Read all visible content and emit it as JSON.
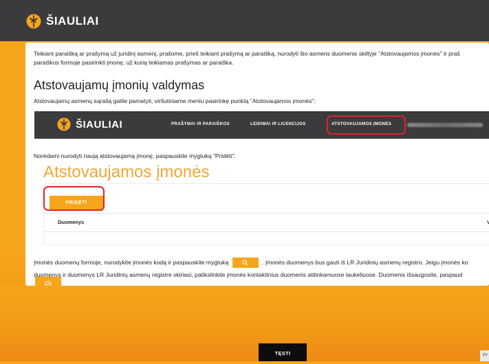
{
  "header": {
    "brand": "ŠIAULIAI"
  },
  "intro": {
    "line1": "Teikiant paraišką ar prašymą už juridinį asmenį, prašome, prieš teikiant prašymą ar paraišką, nurodyti šio asmens duomenis skiltyje \"Atstovaujamos įmonės\" ir praš",
    "line2": "paraiškos formoje pasirinkti įmonę, už kurią teikiamas prašymas ar paraiška."
  },
  "section": {
    "title": "Atstovaujamų įmonių valdymas",
    "subline": "Atstovaujamų asmenų sąrašą galite pamatyti, viršutiniame meniu pasirinkę punktą \"Atstovaujamos įmonės\":"
  },
  "nav_shot": {
    "brand": "ŠIAULIAI",
    "items": [
      "PRAŠYMAI IR PARAIŠKOS",
      "LEIDIMAI IR LICENCIJOS",
      "ATSTOVAUJAMOS ĮMONĖS"
    ]
  },
  "hint": "Norėdami nurodyti naują atstovaujamą įmonę, paspauskite mygtuką \"Pridėti\":",
  "companies": {
    "title": "Atstovaujamos įmonės",
    "add_label": "PRIDĖTI",
    "columns": [
      "Duomenys",
      "V"
    ]
  },
  "instructions": {
    "part1": "Įmonės duomenų formoje, nurodykite įmonės kodą ir paspauskite mygtuką",
    "part2": ". Įmonės duomenys bus gauti iš LR Juridinių asmenų registro. Jeigu įmonės ko",
    "line2": "duomenys ir duomenys LR Juridinių asmenų registre skiriasi, patikslinkite įmonės kontaktinius duomenis atitinkamuose laukeliuose. Duomenis išsaugosite, paspaud"
  },
  "footer": {
    "continue_label": "TĘSTI",
    "corner_label": "Pr"
  },
  "colors": {
    "accent": "#f7a51a",
    "dark": "#3b3b3d",
    "highlight": "#e0232a"
  },
  "icons": [
    "logo-icon",
    "search-icon",
    "check-circle-icon"
  ]
}
